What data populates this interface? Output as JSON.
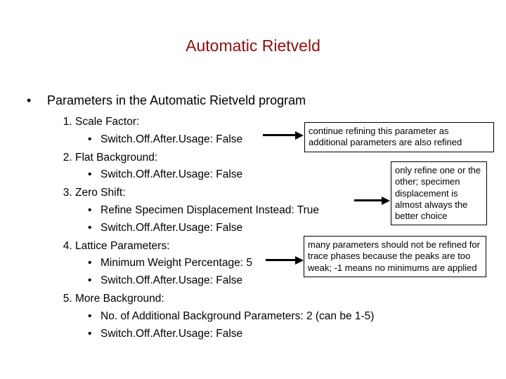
{
  "title": "Automatic Rietveld",
  "subtitle_bullet": "•",
  "subtitle": "Parameters in the Automatic Rietveld program",
  "items": [
    {
      "label": "Scale Factor:",
      "sub": [
        "Switch.Off.After.Usage: False"
      ]
    },
    {
      "label": "Flat Background:",
      "sub": [
        "Switch.Off.After.Usage: False"
      ]
    },
    {
      "label": "Zero Shift:",
      "sub": [
        "Refine Specimen Displacement Instead: True",
        "Switch.Off.After.Usage: False"
      ]
    },
    {
      "label": "Lattice Parameters:",
      "sub": [
        "Minimum Weight Percentage: 5",
        "Switch.Off.After.Usage: False"
      ]
    },
    {
      "label": "More Background:",
      "sub": [
        "No. of Additional Background Parameters: 2 (can be 1-5)",
        "Switch.Off.After.Usage: False"
      ]
    }
  ],
  "callouts": {
    "c1": "continue refining this parameter as additional parameters are also refined",
    "c2": "only refine one or the other; specimen displacement is almost always the better choice",
    "c3": "many parameters should not be refined for trace phases because the peaks are too weak; -1 means no minimums are applied"
  }
}
